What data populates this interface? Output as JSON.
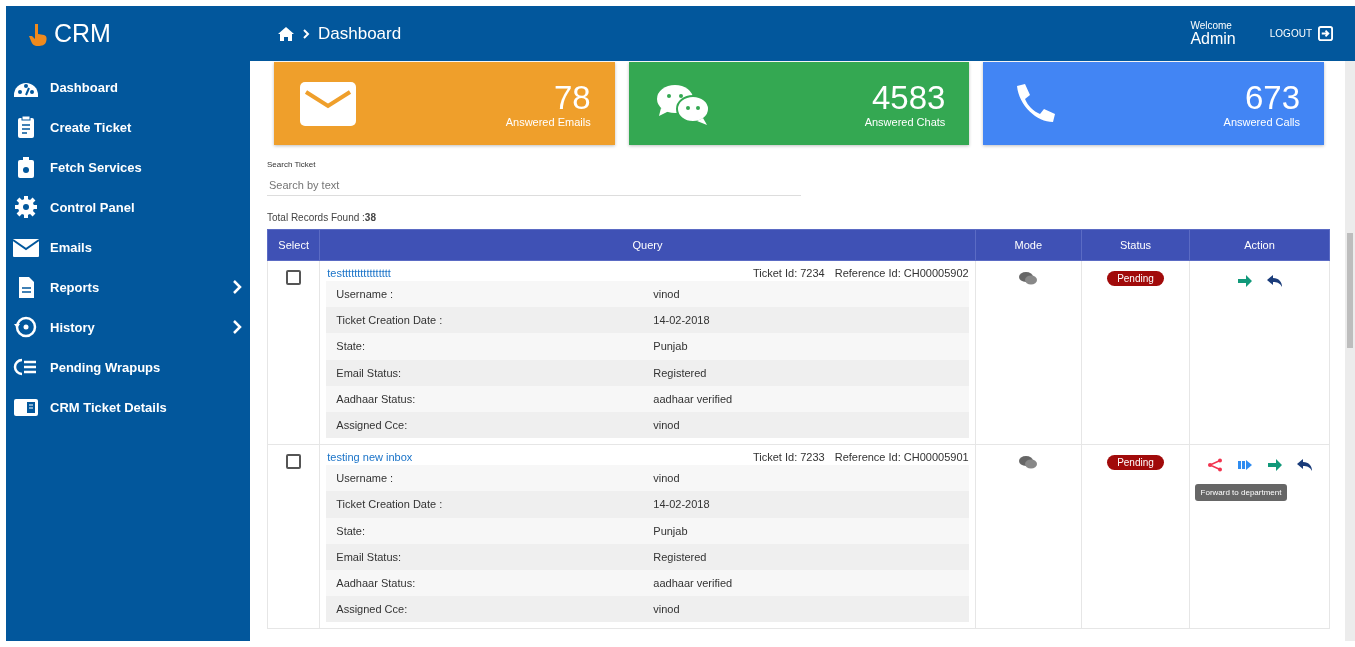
{
  "header": {
    "logo": "CRM",
    "breadcrumb": "Dashboard",
    "welcome": "Welcome",
    "user": "Admin",
    "logout": "LOGOUT"
  },
  "sidebar": {
    "items": [
      {
        "label": "Dashboard",
        "submenu": false
      },
      {
        "label": "Create Ticket",
        "submenu": false
      },
      {
        "label": "Fetch Services",
        "submenu": false
      },
      {
        "label": "Control Panel",
        "submenu": false
      },
      {
        "label": "Emails",
        "submenu": false
      },
      {
        "label": "Reports",
        "submenu": true
      },
      {
        "label": "History",
        "submenu": true
      },
      {
        "label": "Pending Wrapups",
        "submenu": false
      },
      {
        "label": "CRM Ticket Details",
        "submenu": false
      }
    ]
  },
  "stats": [
    {
      "kind": "email",
      "value": "78",
      "label": "Answered Emails",
      "color": "#ef9f2b"
    },
    {
      "kind": "chat",
      "value": "4583",
      "label": "Answered Chats",
      "color": "#34a852"
    },
    {
      "kind": "call",
      "value": "673",
      "label": "Answered Calls",
      "color": "#4285f4"
    }
  ],
  "search": {
    "label": "Search Ticket",
    "placeholder": "Search by text"
  },
  "total": "Total Records Found :**38**",
  "table": {
    "columns": [
      "Select",
      "Query",
      "Mode",
      "Status",
      "Action"
    ],
    "rows": [
      {
        "checked": false,
        "title": "testttttttttttttttt",
        "ticket_id": "Ticket Id: 7234",
        "reference_id": "Reference Id: CH00005902",
        "details": [
          {
            "label": "Username :",
            "value": "vinod"
          },
          {
            "label": "Ticket Creation Date :",
            "value": "14-02-2018"
          },
          {
            "label": "State:",
            "value": "Punjab"
          },
          {
            "label": "Email Status:",
            "value": "Registered"
          },
          {
            "label": "Aadhaar Status:",
            "value": "aadhaar verified"
          },
          {
            "label": "Assigned Cce:",
            "value": "vinod"
          }
        ],
        "mode": {
          "kind": "chat"
        },
        "status": "Pending",
        "actions": [
          {
            "kind": "forward"
          },
          {
            "kind": "reply"
          }
        ]
      },
      {
        "checked": false,
        "title": "testing new inbox",
        "ticket_id": "Ticket Id: 7233",
        "reference_id": "Reference Id: CH00005901",
        "details": [
          {
            "label": "Username :",
            "value": "vinod"
          },
          {
            "label": "Ticket Creation Date :",
            "value": "14-02-2018"
          },
          {
            "label": "State:",
            "value": "Punjab"
          },
          {
            "label": "Email Status:",
            "value": "Registered"
          },
          {
            "label": "Aadhaar Status:",
            "value": "aadhaar verified"
          },
          {
            "label": "Assigned Cce:",
            "value": "vinod"
          }
        ],
        "mode": {
          "kind": "chat"
        },
        "status": "Pending",
        "actions": [
          {
            "kind": "share",
            "tooltip": "Forward to department"
          },
          {
            "kind": "transfer"
          },
          {
            "kind": "forward"
          },
          {
            "kind": "reply"
          }
        ]
      }
    ]
  }
}
